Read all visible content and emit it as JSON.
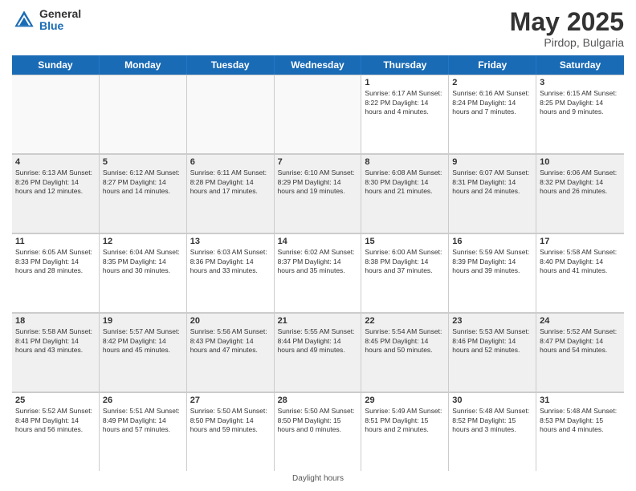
{
  "header": {
    "logo_general": "General",
    "logo_blue": "Blue",
    "month_title": "May 2025",
    "location": "Pirdop, Bulgaria"
  },
  "weekdays": [
    "Sunday",
    "Monday",
    "Tuesday",
    "Wednesday",
    "Thursday",
    "Friday",
    "Saturday"
  ],
  "weeks": [
    [
      {
        "day": "",
        "text": "",
        "empty": true
      },
      {
        "day": "",
        "text": "",
        "empty": true
      },
      {
        "day": "",
        "text": "",
        "empty": true
      },
      {
        "day": "",
        "text": "",
        "empty": true
      },
      {
        "day": "1",
        "text": "Sunrise: 6:17 AM\nSunset: 8:22 PM\nDaylight: 14 hours\nand 4 minutes.",
        "empty": false
      },
      {
        "day": "2",
        "text": "Sunrise: 6:16 AM\nSunset: 8:24 PM\nDaylight: 14 hours\nand 7 minutes.",
        "empty": false
      },
      {
        "day": "3",
        "text": "Sunrise: 6:15 AM\nSunset: 8:25 PM\nDaylight: 14 hours\nand 9 minutes.",
        "empty": false
      }
    ],
    [
      {
        "day": "4",
        "text": "Sunrise: 6:13 AM\nSunset: 8:26 PM\nDaylight: 14 hours\nand 12 minutes.",
        "empty": false
      },
      {
        "day": "5",
        "text": "Sunrise: 6:12 AM\nSunset: 8:27 PM\nDaylight: 14 hours\nand 14 minutes.",
        "empty": false
      },
      {
        "day": "6",
        "text": "Sunrise: 6:11 AM\nSunset: 8:28 PM\nDaylight: 14 hours\nand 17 minutes.",
        "empty": false
      },
      {
        "day": "7",
        "text": "Sunrise: 6:10 AM\nSunset: 8:29 PM\nDaylight: 14 hours\nand 19 minutes.",
        "empty": false
      },
      {
        "day": "8",
        "text": "Sunrise: 6:08 AM\nSunset: 8:30 PM\nDaylight: 14 hours\nand 21 minutes.",
        "empty": false
      },
      {
        "day": "9",
        "text": "Sunrise: 6:07 AM\nSunset: 8:31 PM\nDaylight: 14 hours\nand 24 minutes.",
        "empty": false
      },
      {
        "day": "10",
        "text": "Sunrise: 6:06 AM\nSunset: 8:32 PM\nDaylight: 14 hours\nand 26 minutes.",
        "empty": false
      }
    ],
    [
      {
        "day": "11",
        "text": "Sunrise: 6:05 AM\nSunset: 8:33 PM\nDaylight: 14 hours\nand 28 minutes.",
        "empty": false
      },
      {
        "day": "12",
        "text": "Sunrise: 6:04 AM\nSunset: 8:35 PM\nDaylight: 14 hours\nand 30 minutes.",
        "empty": false
      },
      {
        "day": "13",
        "text": "Sunrise: 6:03 AM\nSunset: 8:36 PM\nDaylight: 14 hours\nand 33 minutes.",
        "empty": false
      },
      {
        "day": "14",
        "text": "Sunrise: 6:02 AM\nSunset: 8:37 PM\nDaylight: 14 hours\nand 35 minutes.",
        "empty": false
      },
      {
        "day": "15",
        "text": "Sunrise: 6:00 AM\nSunset: 8:38 PM\nDaylight: 14 hours\nand 37 minutes.",
        "empty": false
      },
      {
        "day": "16",
        "text": "Sunrise: 5:59 AM\nSunset: 8:39 PM\nDaylight: 14 hours\nand 39 minutes.",
        "empty": false
      },
      {
        "day": "17",
        "text": "Sunrise: 5:58 AM\nSunset: 8:40 PM\nDaylight: 14 hours\nand 41 minutes.",
        "empty": false
      }
    ],
    [
      {
        "day": "18",
        "text": "Sunrise: 5:58 AM\nSunset: 8:41 PM\nDaylight: 14 hours\nand 43 minutes.",
        "empty": false
      },
      {
        "day": "19",
        "text": "Sunrise: 5:57 AM\nSunset: 8:42 PM\nDaylight: 14 hours\nand 45 minutes.",
        "empty": false
      },
      {
        "day": "20",
        "text": "Sunrise: 5:56 AM\nSunset: 8:43 PM\nDaylight: 14 hours\nand 47 minutes.",
        "empty": false
      },
      {
        "day": "21",
        "text": "Sunrise: 5:55 AM\nSunset: 8:44 PM\nDaylight: 14 hours\nand 49 minutes.",
        "empty": false
      },
      {
        "day": "22",
        "text": "Sunrise: 5:54 AM\nSunset: 8:45 PM\nDaylight: 14 hours\nand 50 minutes.",
        "empty": false
      },
      {
        "day": "23",
        "text": "Sunrise: 5:53 AM\nSunset: 8:46 PM\nDaylight: 14 hours\nand 52 minutes.",
        "empty": false
      },
      {
        "day": "24",
        "text": "Sunrise: 5:52 AM\nSunset: 8:47 PM\nDaylight: 14 hours\nand 54 minutes.",
        "empty": false
      }
    ],
    [
      {
        "day": "25",
        "text": "Sunrise: 5:52 AM\nSunset: 8:48 PM\nDaylight: 14 hours\nand 56 minutes.",
        "empty": false
      },
      {
        "day": "26",
        "text": "Sunrise: 5:51 AM\nSunset: 8:49 PM\nDaylight: 14 hours\nand 57 minutes.",
        "empty": false
      },
      {
        "day": "27",
        "text": "Sunrise: 5:50 AM\nSunset: 8:50 PM\nDaylight: 14 hours\nand 59 minutes.",
        "empty": false
      },
      {
        "day": "28",
        "text": "Sunrise: 5:50 AM\nSunset: 8:50 PM\nDaylight: 15 hours\nand 0 minutes.",
        "empty": false
      },
      {
        "day": "29",
        "text": "Sunrise: 5:49 AM\nSunset: 8:51 PM\nDaylight: 15 hours\nand 2 minutes.",
        "empty": false
      },
      {
        "day": "30",
        "text": "Sunrise: 5:48 AM\nSunset: 8:52 PM\nDaylight: 15 hours\nand 3 minutes.",
        "empty": false
      },
      {
        "day": "31",
        "text": "Sunrise: 5:48 AM\nSunset: 8:53 PM\nDaylight: 15 hours\nand 4 minutes.",
        "empty": false
      }
    ]
  ],
  "footer": "Daylight hours"
}
